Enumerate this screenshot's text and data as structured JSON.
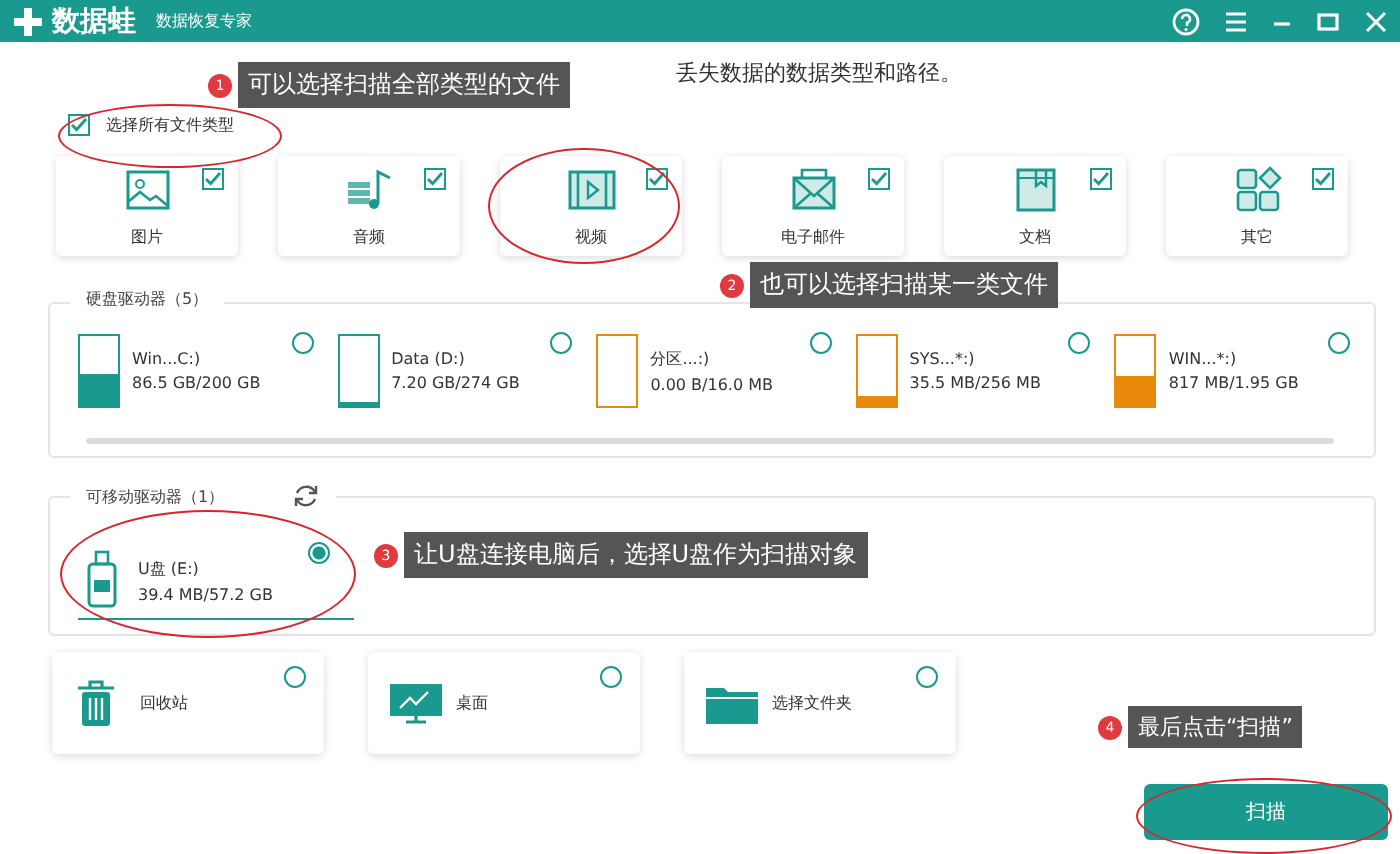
{
  "window": {
    "logo": "数据蛙",
    "subtitle": "数据恢复专家"
  },
  "instruction": "丢失数据的数据类型和路径。",
  "select_all": {
    "label": "选择所有文件类型",
    "checked": true
  },
  "file_types": [
    {
      "label": "图片",
      "kind": "image",
      "checked": true
    },
    {
      "label": "音频",
      "kind": "audio",
      "checked": true
    },
    {
      "label": "视频",
      "kind": "video",
      "checked": true
    },
    {
      "label": "电子邮件",
      "kind": "email",
      "checked": true
    },
    {
      "label": "文档",
      "kind": "document",
      "checked": true
    },
    {
      "label": "其它",
      "kind": "other",
      "checked": true
    }
  ],
  "hard_drives": {
    "title": "硬盘驱动器（5）",
    "drives": [
      {
        "name": "Win...C:)",
        "size": "86.5 GB/200 GB",
        "level": 0.43,
        "color": "#1a9a8e",
        "selected": false
      },
      {
        "name": "Data (D:)",
        "size": "7.20 GB/274 GB",
        "level": 0.03,
        "color": "#1a9a8e",
        "selected": false
      },
      {
        "name": "分区...:)",
        "size": "0.00  B/16.0 MB",
        "level": 0,
        "color": "#e8890c",
        "selected": false
      },
      {
        "name": "SYS...*:)",
        "size": "35.5 MB/256 MB",
        "level": 0.14,
        "color": "#e8890c",
        "selected": false
      },
      {
        "name": "WIN...*:)",
        "size": "817 MB/1.95 GB",
        "level": 0.42,
        "color": "#e8890c",
        "selected": false
      }
    ]
  },
  "removable_drives": {
    "title": "可移动驱动器（1）",
    "drives": [
      {
        "name": "U盘 (E:)",
        "size": "39.4 MB/57.2 GB",
        "selected": true
      }
    ]
  },
  "locations": [
    {
      "label": "回收站",
      "kind": "trash",
      "selected": false
    },
    {
      "label": "桌面",
      "kind": "desktop",
      "selected": false
    },
    {
      "label": "选择文件夹",
      "kind": "folder",
      "selected": false
    }
  ],
  "scan_button": "扫描",
  "annotations": [
    {
      "number": "1",
      "text": "可以选择扫描全部类型的文件"
    },
    {
      "number": "2",
      "text": "也可以选择扫描某一类文件"
    },
    {
      "number": "3",
      "text": "让U盘连接电脑后，选择U盘作为扫描对象"
    },
    {
      "number": "4",
      "text": "最后点击“扫描”"
    }
  ]
}
